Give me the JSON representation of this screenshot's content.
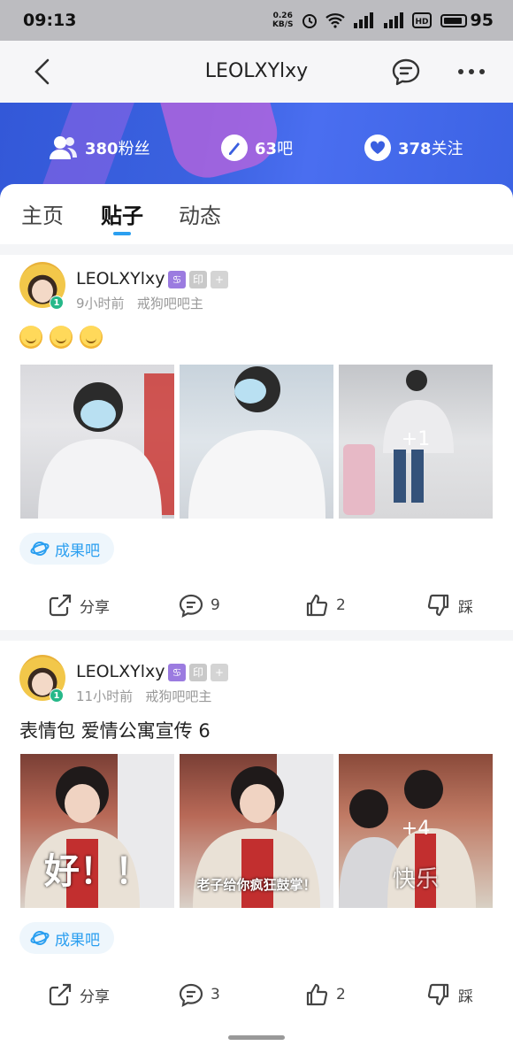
{
  "status": {
    "time": "09:13",
    "net_speed": "0.26\nKB/S",
    "battery": "95"
  },
  "nav": {
    "title": "LEOLXYlxy"
  },
  "stats": [
    {
      "value": "380",
      "label": "粉丝",
      "icon": "fans-icon"
    },
    {
      "value": "63",
      "label": "吧",
      "icon": "bar-icon"
    },
    {
      "value": "378",
      "label": "关注",
      "icon": "heart-icon"
    }
  ],
  "tabs": [
    {
      "label": "主页"
    },
    {
      "label": "贴子"
    },
    {
      "label": "动态"
    }
  ],
  "posts": [
    {
      "user": "LEOLXYlxy",
      "level": "1",
      "badge_text": "印",
      "time": "9小时前",
      "forum_role": "戒狗吧吧主",
      "text": "",
      "emoji_count": 3,
      "images": [
        {
          "overlay": "",
          "caption": ""
        },
        {
          "overlay": "",
          "caption": ""
        },
        {
          "overlay": "+1",
          "caption": ""
        }
      ],
      "forum": "成果吧",
      "actions": {
        "share": "分享",
        "comments": "9",
        "likes": "2",
        "dislike": "踩"
      }
    },
    {
      "user": "LEOLXYlxy",
      "level": "1",
      "badge_text": "印",
      "time": "11小时前",
      "forum_role": "戒狗吧吧主",
      "text": "表情包 爱情公寓宣传 6",
      "emoji_count": 0,
      "images": [
        {
          "overlay": "",
          "caption": "好！！"
        },
        {
          "overlay": "",
          "caption": "老子给你疯狂鼓掌！"
        },
        {
          "overlay": "+4",
          "caption": "快乐"
        }
      ],
      "forum": "成果吧",
      "actions": {
        "share": "分享",
        "comments": "3",
        "likes": "2",
        "dislike": "踩"
      }
    }
  ]
}
